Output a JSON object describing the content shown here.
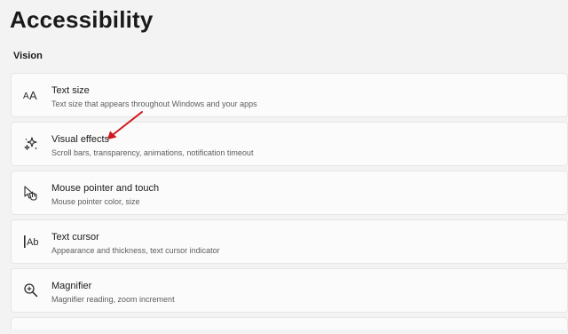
{
  "page": {
    "title": "Accessibility",
    "section": "Vision"
  },
  "settings": [
    {
      "icon": "text-size-icon",
      "title": "Text size",
      "description": "Text size that appears throughout Windows and your apps"
    },
    {
      "icon": "visual-effects-icon",
      "title": "Visual effects",
      "description": "Scroll bars, transparency, animations, notification timeout"
    },
    {
      "icon": "mouse-pointer-touch-icon",
      "title": "Mouse pointer and touch",
      "description": "Mouse pointer color, size"
    },
    {
      "icon": "text-cursor-icon",
      "title": "Text cursor",
      "description": "Appearance and thickness, text cursor indicator"
    },
    {
      "icon": "magnifier-icon",
      "title": "Magnifier",
      "description": "Magnifier reading, zoom increment"
    }
  ],
  "annotation": {
    "color": "#d0191f"
  }
}
